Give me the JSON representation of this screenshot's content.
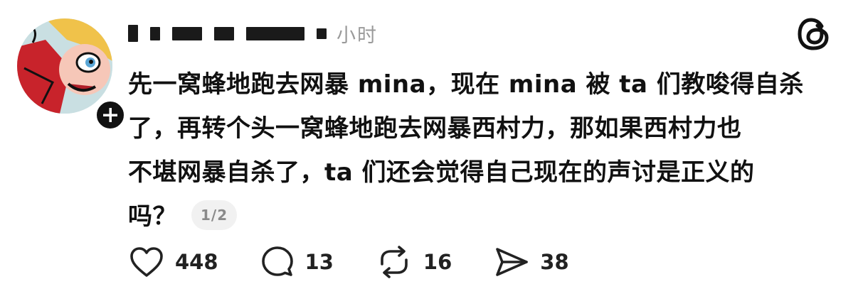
{
  "header": {
    "timestamp": "小时"
  },
  "post": {
    "lines": [
      "先一窝蜂地跑去网暴 mina，现在 mina 被 ta 们教唆得自杀",
      "了，再转个头一窝蜂地跑去网暴西村力，那如果西村力也",
      "不堪网暴自杀了，ta 们还会觉得自己现在的声讨是正义的",
      "吗？"
    ],
    "page_indicator": "1/2"
  },
  "actions": {
    "likes": "448",
    "comments": "13",
    "reposts": "16",
    "shares": "38"
  },
  "icons": {
    "follow": "plus-icon",
    "brand": "threads-logo-icon",
    "like": "heart-icon",
    "comment": "speech-bubble-icon",
    "repost": "repost-arrows-icon",
    "share": "paper-plane-icon"
  },
  "colors": {
    "text": "#111111",
    "muted": "#9a9a9a",
    "badge": "#111111"
  }
}
